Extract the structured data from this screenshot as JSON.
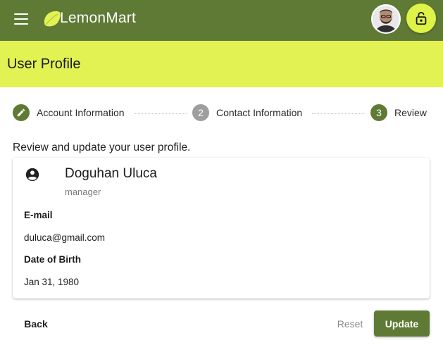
{
  "app": {
    "title": "LemonMart"
  },
  "header": {
    "title": "User Profile"
  },
  "stepper": {
    "steps": [
      {
        "indicator": "",
        "label": "Account Information",
        "state": "edit"
      },
      {
        "indicator": "2",
        "label": "Contact Information",
        "state": "done"
      },
      {
        "indicator": "3",
        "label": "Review",
        "state": "active"
      }
    ]
  },
  "review": {
    "intro": "Review and update your user profile.",
    "name": "Doguhan Uluca",
    "role": "manager",
    "email_label": "E-mail",
    "email": "duluca@gmail.com",
    "dob_label": "Date of Birth",
    "dob": "Jan 31, 1980"
  },
  "actions": {
    "back": "Back",
    "reset": "Reset",
    "update": "Update"
  },
  "colors": {
    "primary": "#5f7a35",
    "accent": "#e2f252",
    "inactive_step": "#9e9e9e"
  },
  "icons": [
    "menu-icon",
    "lemon-logo-icon",
    "lock-open-icon",
    "pencil-icon",
    "account-circle-icon"
  ]
}
